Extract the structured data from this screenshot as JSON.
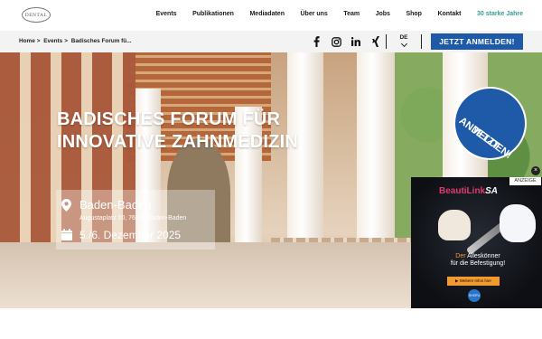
{
  "header": {
    "logo_text": "DENTAL",
    "nav": [
      {
        "label": "Events"
      },
      {
        "label": "Publikationen"
      },
      {
        "label": "Mediadaten"
      },
      {
        "label": "Über uns"
      },
      {
        "label": "Team"
      },
      {
        "label": "Jobs"
      },
      {
        "label": "Shop"
      },
      {
        "label": "Kontakt"
      },
      {
        "label": "30 starke Jahre"
      }
    ]
  },
  "breadcrumb": {
    "items": [
      "Home",
      "Events",
      "Badisches Forum fü..."
    ],
    "separator": ">"
  },
  "social_icons": [
    "facebook-icon",
    "instagram-icon",
    "linkedin-icon",
    "xing-icon"
  ],
  "language": {
    "current": "DE"
  },
  "cta_button": {
    "label": "JETZT ANMELDEN!"
  },
  "hero": {
    "title_line1": "BADISCHES FORUM FÜR",
    "title_line2": "INNOVATIVE ZAHNMEDIZIN",
    "city": "Baden-Baden",
    "address": "Augustaplatz 10, 76530 Baden-Baden",
    "date": "5./6. Dezember 2025",
    "badge_line1": "JETZT",
    "badge_line2": "ANMELDEN!"
  },
  "ad": {
    "label": "ANZEIGE",
    "close_symbol": "×",
    "brand_main": "BeautiLink",
    "brand_suffix": "SA",
    "text_highlight": "Der",
    "text_rest": " Alleskönner",
    "text_line2": "für die Befestigung!",
    "button_label": "▶ Weitere Infos hier",
    "logo_text": "SHOFU"
  },
  "colors": {
    "accent_blue": "#1e5aa8",
    "accent_teal": "#2e9e93",
    "ad_orange": "#f29a2e"
  }
}
